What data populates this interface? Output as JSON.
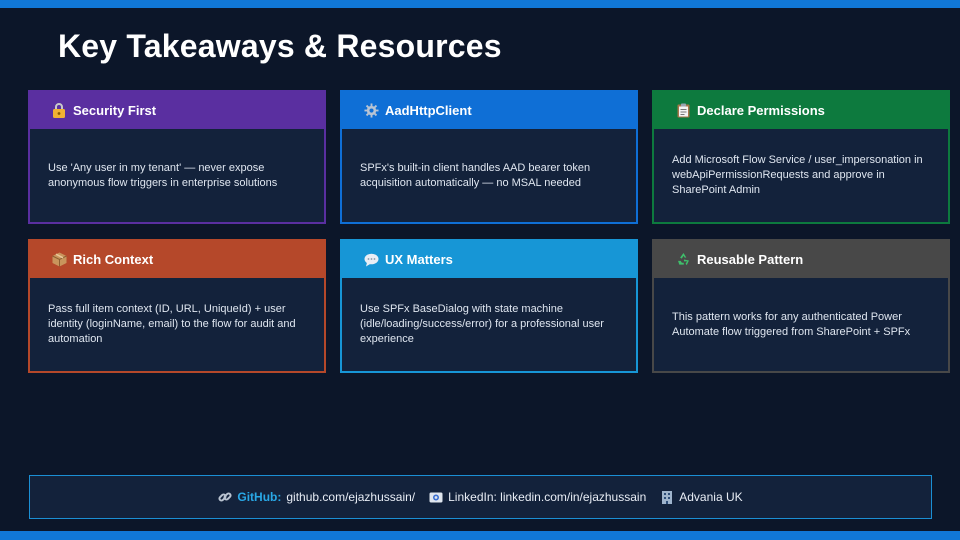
{
  "slide": {
    "title": "Key Takeaways & Resources"
  },
  "cards": [
    {
      "title": "Security First",
      "icon": "lock-icon",
      "color": "#5a2fa0",
      "text": "Use 'Any user in my tenant' — never expose anonymous flow triggers in enterprise solutions"
    },
    {
      "title": "AadHttpClient",
      "icon": "gear-icon",
      "color": "#0f6fd6",
      "text": "SPFx's built-in client handles AAD bearer token acquisition automatically — no MSAL needed"
    },
    {
      "title": "Declare Permissions",
      "icon": "clipboard-icon",
      "color": "#0d7a3e",
      "text": "Add Microsoft Flow Service / user_impersonation in webApiPermissionRequests and approve in SharePoint Admin"
    },
    {
      "title": "Rich Context",
      "icon": "package-icon",
      "color": "#b5482a",
      "text": "Pass full item context (ID, URL, UniqueId) + user identity (loginName, email) to the flow for audit and automation"
    },
    {
      "title": "UX Matters",
      "icon": "speech-bubble-icon",
      "color": "#1796d6",
      "text": "Use SPFx BaseDialog with state machine (idle/loading/success/error) for a professional user experience"
    },
    {
      "title": "Reusable Pattern",
      "icon": "recycle-icon",
      "color": "#484848",
      "text": "This pattern works for any authenticated Power Automate flow triggered from SharePoint + SPFx"
    }
  ],
  "footer": {
    "github_label": "GitHub:",
    "github_value": "github.com/ejazhussain/",
    "linkedin": "LinkedIn: linkedin.com/in/ejazhussain",
    "company": "Advania UK",
    "accent": "#1b8fd4"
  }
}
